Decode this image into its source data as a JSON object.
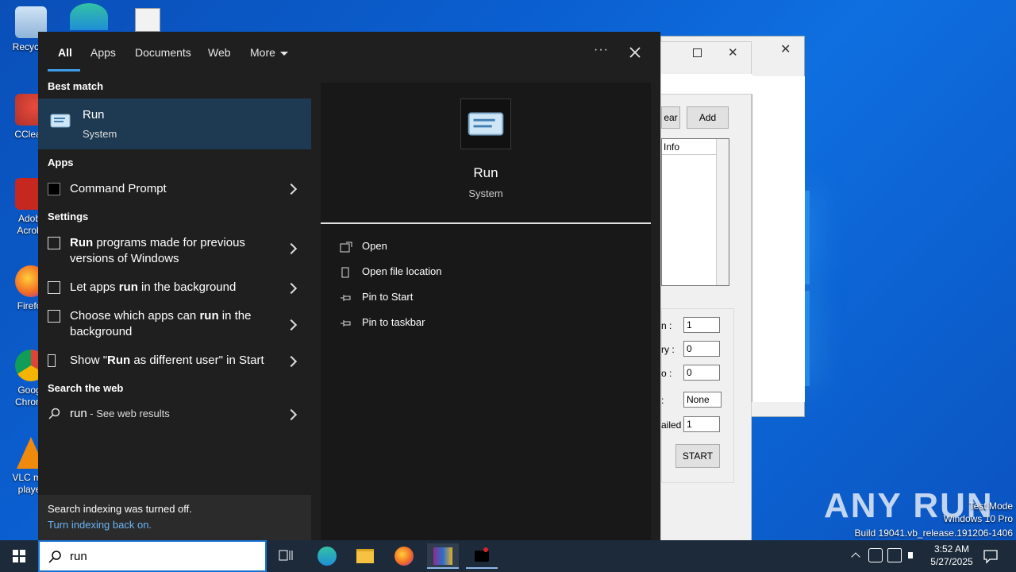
{
  "desktop": {
    "icons": [
      {
        "label": "Recycle",
        "icon": "recycle-bin-icon"
      },
      {
        "label": "CClear",
        "icon": "ccleaner-icon"
      },
      {
        "label": "Adob\nAcrob",
        "icon": "adobe-acrobat-icon"
      },
      {
        "label": "Firefo",
        "icon": "firefox-icon"
      },
      {
        "label": "Goog\nChrom",
        "icon": "chrome-icon"
      },
      {
        "label": "VLC me\nplaye",
        "icon": "vlc-icon"
      }
    ]
  },
  "background_window": {
    "buttons": {
      "clear": "ear",
      "add": "Add",
      "start": "START"
    },
    "list_header": "Info",
    "fields": [
      {
        "label": "n :",
        "value": "1"
      },
      {
        "label": "ry :",
        "value": "0"
      },
      {
        "label": "o :",
        "value": "0"
      },
      {
        "label": ":",
        "value": "None"
      },
      {
        "label": "ailed",
        "value": "1"
      }
    ]
  },
  "search": {
    "tabs": [
      {
        "label": "All",
        "active": true
      },
      {
        "label": "Apps"
      },
      {
        "label": "Documents"
      },
      {
        "label": "Web"
      },
      {
        "label": "More"
      }
    ],
    "more_options": "···",
    "best_match_heading": "Best match",
    "best_match": {
      "title": "Run",
      "subtitle": "System"
    },
    "apps_heading": "Apps",
    "apps": [
      {
        "label": "Command Prompt"
      }
    ],
    "settings_heading": "Settings",
    "settings": [
      {
        "bold": "Run",
        "rest": " programs made for previous versions of Windows"
      },
      {
        "pre": "Let apps ",
        "bold": "run",
        "rest": " in the background"
      },
      {
        "pre": "Choose which apps can ",
        "bold": "run",
        "rest": " in the background"
      },
      {
        "pre": "Show \"",
        "bold": "Run",
        "rest": " as different user\" in Start"
      }
    ],
    "web_heading": "Search the web",
    "web": {
      "query": "run",
      "suffix": " - See web results"
    },
    "indexing": {
      "message": "Search indexing was turned off.",
      "link": "Turn indexing back on."
    },
    "detail": {
      "title": "Run",
      "subtitle": "System",
      "actions": [
        "Open",
        "Open file location",
        "Pin to Start",
        "Pin to taskbar"
      ]
    },
    "query": "run"
  },
  "taskbar": {
    "time": "3:52 AM",
    "date": "5/27/2025"
  },
  "watermark": {
    "logo": "ANY RUN",
    "mode": "Test Mode",
    "os": "Windows 10 Pro",
    "build": "Build 19041.vb_release.191206-1406"
  }
}
